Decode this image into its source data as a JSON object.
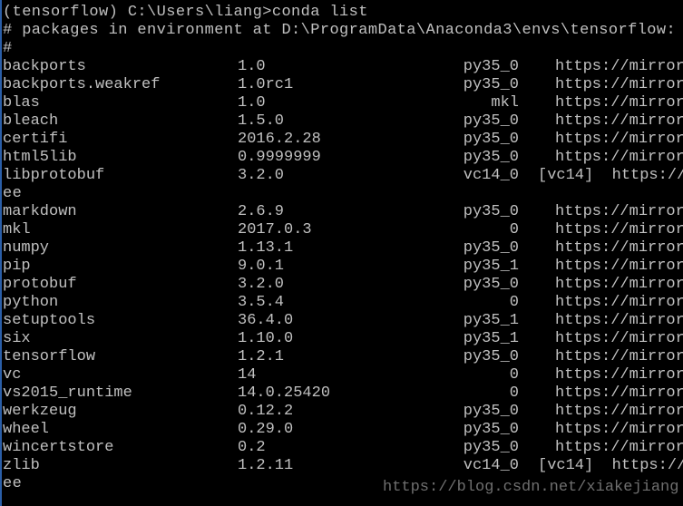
{
  "terminal": {
    "prompt_line": "(tensorflow) C:\\Users\\liang>conda list",
    "header_line": "# packages in environment at D:\\ProgramData\\Anaconda3\\envs\\tensorflow:",
    "hash_line": "#",
    "packages": [
      {
        "name": "backports",
        "version": "1.0",
        "build": "py35_0",
        "channel": "https://mirror"
      },
      {
        "name": "backports.weakref",
        "version": "1.0rc1",
        "build": "py35_0",
        "channel": "https://mirror"
      },
      {
        "name": "blas",
        "version": "1.0",
        "build": "mkl",
        "channel": "https://mirror"
      },
      {
        "name": "bleach",
        "version": "1.5.0",
        "build": "py35_0",
        "channel": "https://mirror"
      },
      {
        "name": "certifi",
        "version": "2016.2.28",
        "build": "py35_0",
        "channel": "https://mirror"
      },
      {
        "name": "html5lib",
        "version": "0.9999999",
        "build": "py35_0",
        "channel": "https://mirror"
      },
      {
        "name": "libprotobuf",
        "version": "3.2.0",
        "build": "vc14_0",
        "channel": "[vc14]  https://",
        "wrap": "ee"
      },
      {
        "name": "markdown",
        "version": "2.6.9",
        "build": "py35_0",
        "channel": "https://mirror"
      },
      {
        "name": "mkl",
        "version": "2017.0.3",
        "build": "0",
        "channel": "https://mirror"
      },
      {
        "name": "numpy",
        "version": "1.13.1",
        "build": "py35_0",
        "channel": "https://mirror"
      },
      {
        "name": "pip",
        "version": "9.0.1",
        "build": "py35_1",
        "channel": "https://mirror"
      },
      {
        "name": "protobuf",
        "version": "3.2.0",
        "build": "py35_0",
        "channel": "https://mirror"
      },
      {
        "name": "python",
        "version": "3.5.4",
        "build": "0",
        "channel": "https://mirror"
      },
      {
        "name": "setuptools",
        "version": "36.4.0",
        "build": "py35_1",
        "channel": "https://mirror"
      },
      {
        "name": "six",
        "version": "1.10.0",
        "build": "py35_1",
        "channel": "https://mirror"
      },
      {
        "name": "tensorflow",
        "version": "1.2.1",
        "build": "py35_0",
        "channel": "https://mirror"
      },
      {
        "name": "vc",
        "version": "14",
        "build": "0",
        "channel": "https://mirror"
      },
      {
        "name": "vs2015_runtime",
        "version": "14.0.25420",
        "build": "0",
        "channel": "https://mirror"
      },
      {
        "name": "werkzeug",
        "version": "0.12.2",
        "build": "py35_0",
        "channel": "https://mirror"
      },
      {
        "name": "wheel",
        "version": "0.29.0",
        "build": "py35_0",
        "channel": "https://mirror"
      },
      {
        "name": "wincertstore",
        "version": "0.2",
        "build": "py35_0",
        "channel": "https://mirror"
      },
      {
        "name": "zlib",
        "version": "1.2.11",
        "build": "vc14_0",
        "channel": "[vc14]  https://",
        "wrap": "ee"
      }
    ]
  },
  "watermark": "https://blog.csdn.net/xiakejiang"
}
